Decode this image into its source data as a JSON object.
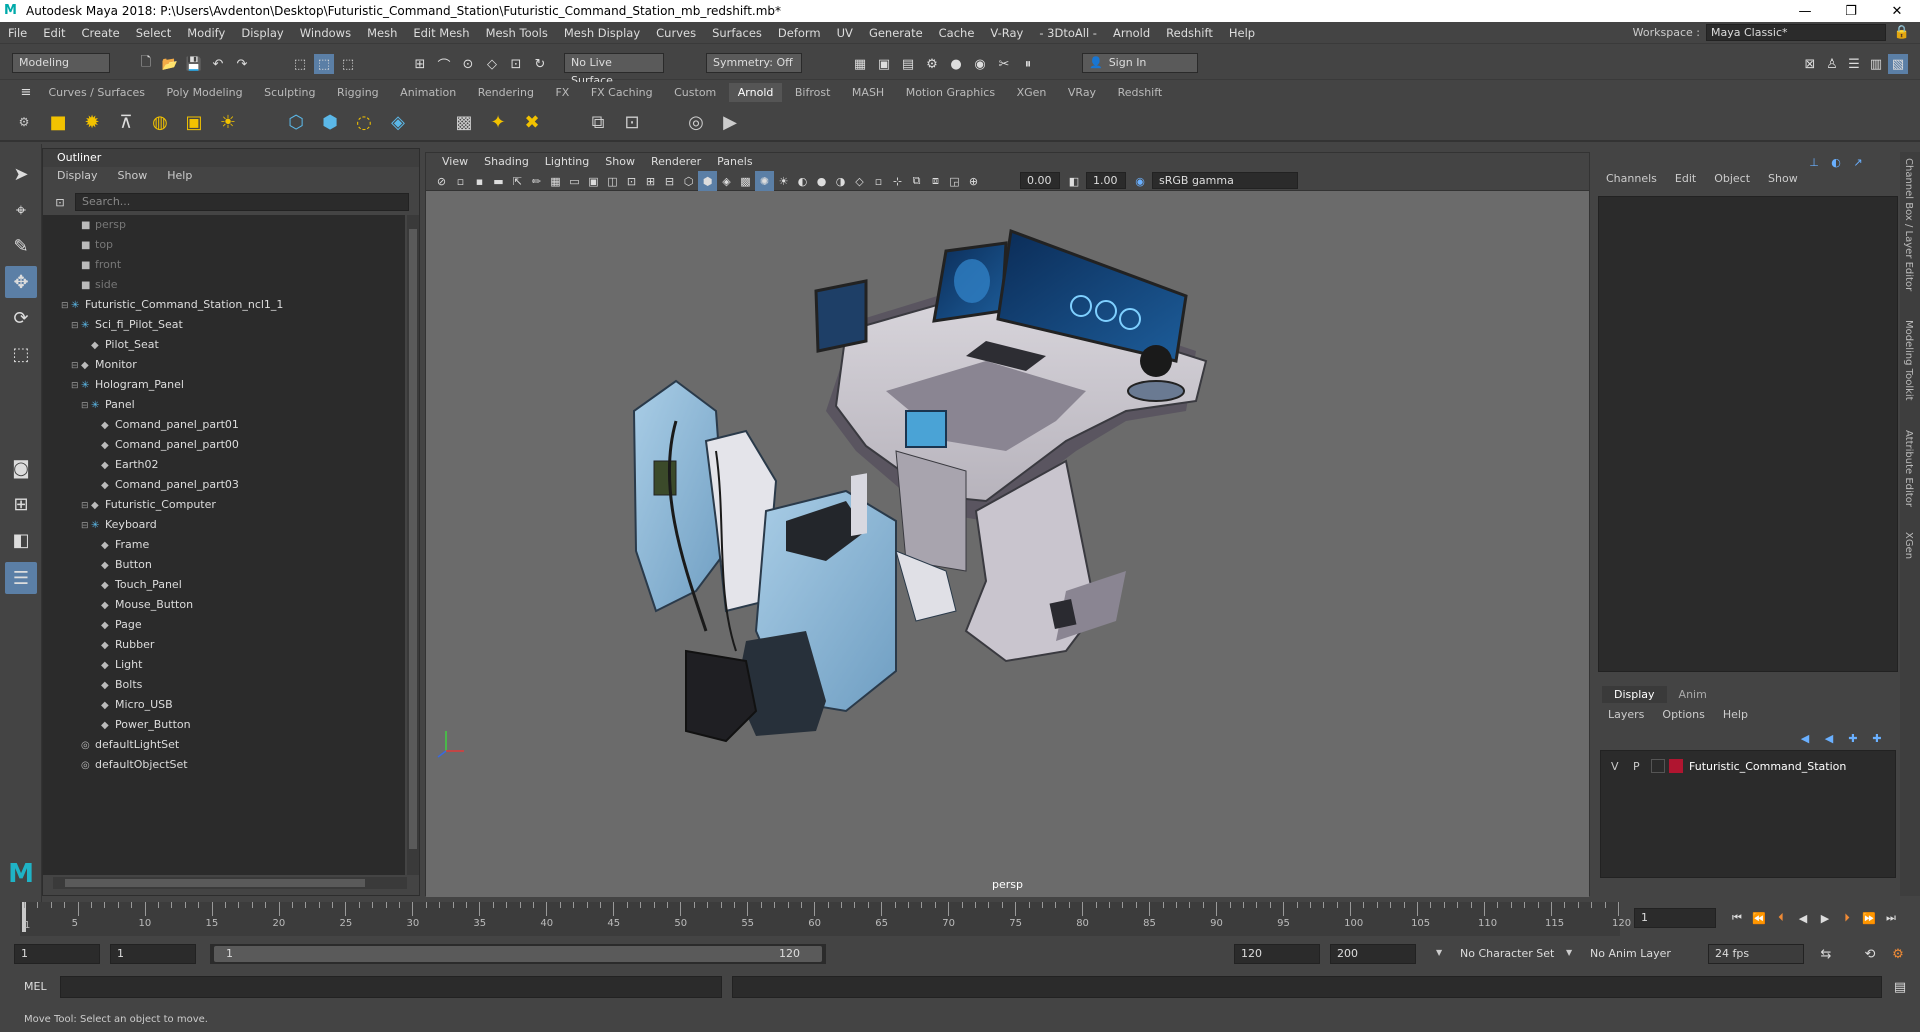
{
  "window": {
    "app_logo": "M",
    "title": "Autodesk Maya 2018: P:\\Users\\Avdenton\\Desktop\\Futuristic_Command_Station\\Futuristic_Command_Station_mb_redshift.mb*",
    "controls": [
      "—",
      "❐",
      "✕"
    ]
  },
  "menubar": {
    "items": [
      "File",
      "Edit",
      "Create",
      "Select",
      "Modify",
      "Display",
      "Windows",
      "Mesh",
      "Edit Mesh",
      "Mesh Tools",
      "Mesh Display",
      "Curves",
      "Surfaces",
      "Deform",
      "UV",
      "Generate",
      "Cache",
      "V-Ray",
      "- 3DtoAll -",
      "Arnold",
      "Redshift",
      "Help"
    ],
    "workspace_label": "Workspace :",
    "workspace_value": "Maya Classic*"
  },
  "statusline": {
    "mode": "Modeling",
    "live_surface": "No Live Surface",
    "symmetry": "Symmetry: Off",
    "sign_in": "Sign In"
  },
  "shelf": {
    "tabs": [
      "Curves / Surfaces",
      "Poly Modeling",
      "Sculpting",
      "Rigging",
      "Animation",
      "Rendering",
      "FX",
      "FX Caching",
      "Custom",
      "Arnold",
      "Bifrost",
      "MASH",
      "Motion Graphics",
      "XGen",
      "VRay",
      "Redshift"
    ],
    "active_tab": "Arnold"
  },
  "outliner": {
    "title": "Outliner",
    "menu": [
      "Display",
      "Show",
      "Help"
    ],
    "search_placeholder": "Search...",
    "rows": [
      {
        "label": "persp",
        "dim": true
      },
      {
        "label": "top",
        "dim": true
      },
      {
        "label": "front",
        "dim": true
      },
      {
        "label": "side",
        "dim": true
      },
      {
        "label": "Futuristic_Command_Station_ncl1_1"
      },
      {
        "label": "Sci_fi_Pilot_Seat"
      },
      {
        "label": "Pilot_Seat"
      },
      {
        "label": "Monitor"
      },
      {
        "label": "Hologram_Panel"
      },
      {
        "label": "Panel"
      },
      {
        "label": "Comand_panel_part01"
      },
      {
        "label": "Comand_panel_part00"
      },
      {
        "label": "Earth02"
      },
      {
        "label": "Comand_panel_part03"
      },
      {
        "label": "Futuristic_Computer"
      },
      {
        "label": "Keyboard"
      },
      {
        "label": "Frame"
      },
      {
        "label": "Button"
      },
      {
        "label": "Touch_Panel"
      },
      {
        "label": "Mouse_Button"
      },
      {
        "label": "Page"
      },
      {
        "label": "Rubber"
      },
      {
        "label": "Light"
      },
      {
        "label": "Bolts"
      },
      {
        "label": "Micro_USB"
      },
      {
        "label": "Power_Button"
      },
      {
        "label": "defaultLightSet"
      },
      {
        "label": "defaultObjectSet"
      }
    ]
  },
  "viewport": {
    "menu": [
      "View",
      "Shading",
      "Lighting",
      "Show",
      "Renderer",
      "Panels"
    ],
    "exposure": "0.00",
    "gamma": "1.00",
    "color_space": "sRGB gamma",
    "camera_label": "persp"
  },
  "channelbox": {
    "menu": [
      "Channels",
      "Edit",
      "Object",
      "Show"
    ],
    "layer_tabs": [
      "Display",
      "Anim"
    ],
    "layer_menu": [
      "Layers",
      "Options",
      "Help"
    ],
    "layer": {
      "v": "V",
      "p": "P",
      "name": "Futuristic_Command_Station",
      "color": "#b01530"
    }
  },
  "side_tabs": [
    "Channel Box / Layer Editor",
    "Modeling Toolkit",
    "Attribute Editor",
    "XGen"
  ],
  "timeline": {
    "ticks": [
      "5",
      "10",
      "15",
      "20",
      "25",
      "30",
      "35",
      "40",
      "45",
      "50",
      "55",
      "60",
      "65",
      "70",
      "75",
      "80",
      "85",
      "90",
      "95",
      "100",
      "105",
      "110",
      "115",
      "120"
    ],
    "start_tick": "1",
    "current_frame": "1"
  },
  "range": {
    "start": "1",
    "playback_start": "1",
    "slider_start": "1",
    "slider_end": "120",
    "playback_end": "120",
    "end": "200",
    "character_set": "No Character Set",
    "anim_layer": "No Anim Layer",
    "fps": "24 fps"
  },
  "command": {
    "label": "MEL"
  },
  "help_line": "Move Tool: Select an object to move."
}
